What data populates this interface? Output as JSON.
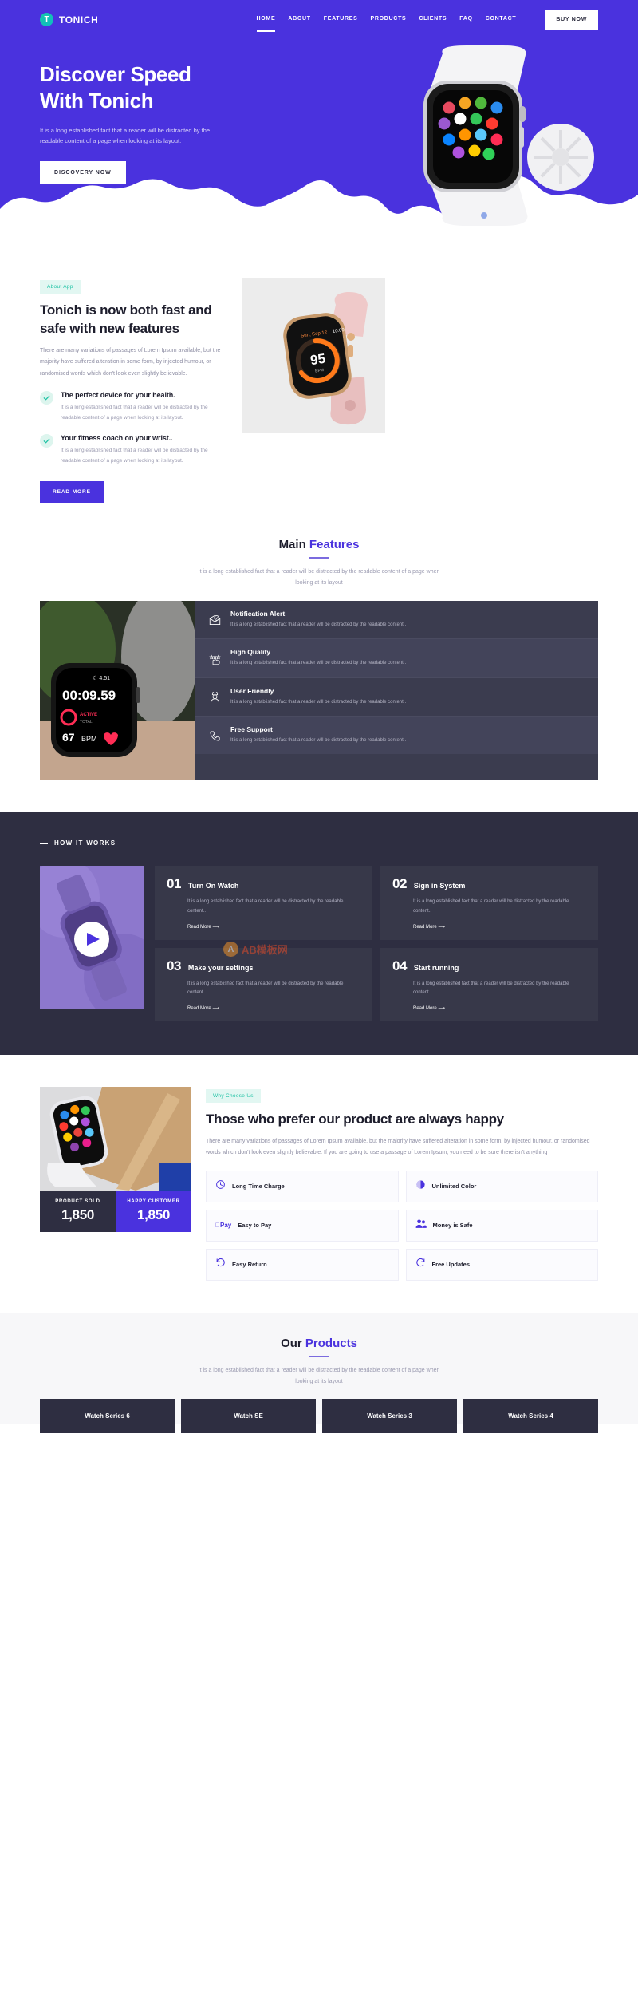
{
  "brand": {
    "mark": "T",
    "name": "TONICH"
  },
  "nav": {
    "links": [
      {
        "label": "HOME",
        "active": true
      },
      {
        "label": "ABOUT",
        "active": false
      },
      {
        "label": "FEATURES",
        "active": false
      },
      {
        "label": "PRODUCTS",
        "active": false
      },
      {
        "label": "CLIENTS",
        "active": false
      },
      {
        "label": "FAQ",
        "active": false
      },
      {
        "label": "CONTACT",
        "active": false
      }
    ],
    "buy_label": "BUY NOW"
  },
  "hero": {
    "title_line1": "Discover Speed",
    "title_line2": "With Tonich",
    "text": "It is a long established fact that a reader will be distracted by the readable content of a page when looking at its layout.",
    "cta": "DISCOVERY NOW"
  },
  "about": {
    "badge": "About App",
    "title": "Tonich is now both fast and safe with new features",
    "text": "There are many variations of passages of Lorem Ipsum available, but the majority have suffered alteration in some form, by injected humour, or randomised words which don't look even slightly believable.",
    "points": [
      {
        "title": "The perfect device for your health.",
        "text": "It is a long established fact that a reader will be distracted by the readable content of a page when looking at its layout."
      },
      {
        "title": "Your fitness coach on your wrist..",
        "text": "It is a long established fact that a reader will be distracted by the readable content of a page when looking at its layout."
      }
    ],
    "cta": "READ MORE"
  },
  "features": {
    "title_main": "Main ",
    "title_hl": "Features",
    "subtitle": "It is a long established fact that a reader will be distracted by the readable content of a page when looking at its layout",
    "watch_time": "00:09.59",
    "watch_clock": "4:51",
    "watch_active": "ACTIVE",
    "watch_total": "TOTAL",
    "watch_bpm": "67 BPM",
    "items": [
      {
        "icon": "mail-check-icon",
        "name": "Notification Alert",
        "desc": "It is a long established fact that a reader will be distracted by the readable content.."
      },
      {
        "icon": "rating-hand-icon",
        "name": "High Quality",
        "desc": "It is a long established fact that a reader will be distracted by the readable content.."
      },
      {
        "icon": "support-agent-icon",
        "name": "User Friendly",
        "desc": "It is a long established fact that a reader will be distracted by the readable content.."
      },
      {
        "icon": "phone-call-icon",
        "name": "Free Support",
        "desc": "It is a long established fact that a reader will be distracted by the readable content.."
      }
    ]
  },
  "how": {
    "label": "HOW IT WORKS",
    "steps": [
      {
        "num": "01",
        "title": "Turn On Watch",
        "text": "It is a long established fact that a reader will be distracted by the readable content..",
        "more": "Read More"
      },
      {
        "num": "02",
        "title": "Sign in System",
        "text": "It is a long established fact that a reader will be distracted by the readable content..",
        "more": "Read More"
      },
      {
        "num": "03",
        "title": "Make your settings",
        "text": "It is a long established fact that a reader will be distracted by the readable content..",
        "more": "Read More"
      },
      {
        "num": "04",
        "title": "Start running",
        "text": "It is a long established fact that a reader will be distracted by the readable content..",
        "more": "Read More"
      }
    ]
  },
  "why": {
    "badge": "Why Choose Us",
    "title": "Those who prefer our product are always happy",
    "text": "There are many variations of passages of Lorem Ipsum available, but the majority have suffered alteration in some form, by injected humour, or randomised words which don't look even slightly believable. If you are going to use a passage of Lorem Ipsum, you need to be sure there isn't anything",
    "cards": [
      {
        "icon": "clock-icon",
        "label": "Long Time Charge"
      },
      {
        "icon": "contrast-circle-icon",
        "label": "Unlimited Color"
      },
      {
        "icon": "apple-pay-icon",
        "label": "Easy to Pay"
      },
      {
        "icon": "people-icon",
        "label": "Money is Safe"
      },
      {
        "icon": "return-arrow-icon",
        "label": "Easy Return"
      },
      {
        "icon": "refresh-icon",
        "label": "Free Updates"
      }
    ],
    "stats": [
      {
        "label": "PRODUCT SOLD",
        "value": "1,850"
      },
      {
        "label": "HAPPY CUSTOMER",
        "value": "1,850"
      }
    ]
  },
  "products": {
    "title_main": "Our ",
    "title_hl": "Products",
    "subtitle": "It is a long established fact that a reader will be distracted by the readable content of a page when looking at its layout",
    "tabs": [
      {
        "label": "Watch Series 6"
      },
      {
        "label": "Watch SE"
      },
      {
        "label": "Watch Series 3"
      },
      {
        "label": "Watch Series 4"
      }
    ]
  },
  "watermark": {
    "mark": "A",
    "text": "AB模板网"
  },
  "colors": {
    "brand": "#4a32de",
    "dark": "#2e2e41",
    "teal": "#1ec2a4",
    "panel": "#3b3c4f"
  }
}
